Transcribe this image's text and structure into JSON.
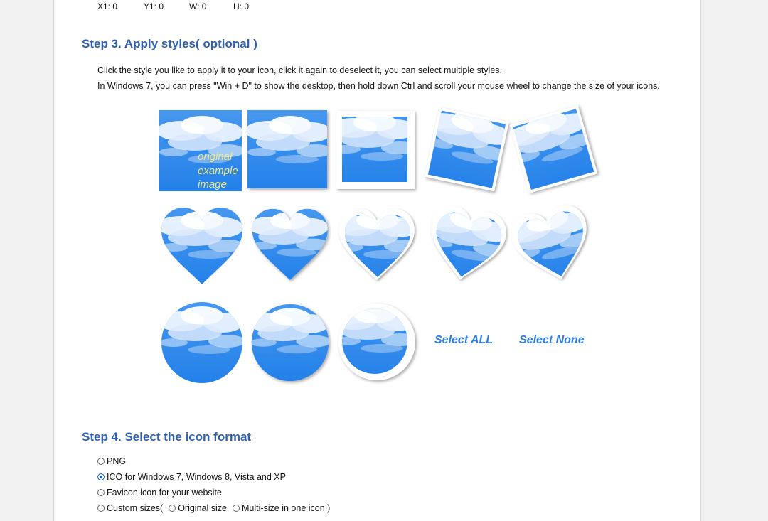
{
  "coords": {
    "x1": "X1: 0",
    "y1": "Y1: 0",
    "w": "W: 0",
    "h": "H: 0"
  },
  "step3": {
    "title": "Step 3. Apply styles( optional )",
    "line1": "Click the style you like to apply it to your icon, click it again to deselect it, you can select multiple styles.",
    "line2": "In Windows 7, you can press \"Win + D\" to show the desktop, then hold down Ctrl and scroll your mouse wheel to change the size of your icons.",
    "example_caption": [
      "original",
      "example",
      "image"
    ],
    "select_all": "Select ALL",
    "select_none": "Select None"
  },
  "step4": {
    "title": "Step 4. Select the icon format",
    "options": [
      {
        "label": "PNG",
        "selected": false
      },
      {
        "label": "ICO for Windows 7, Windows 8, Vista and XP",
        "selected": true
      },
      {
        "label": "Favicon icon for your website",
        "selected": false
      }
    ],
    "custom_label": "Custom sizes(",
    "original_size": "Original size",
    "multi_size": "Multi-size in one icon )"
  },
  "colors": {
    "heading": "#2f5fb3",
    "link": "#2b7de9",
    "sky": "#2e86ea",
    "caption": "#f2e97a"
  }
}
